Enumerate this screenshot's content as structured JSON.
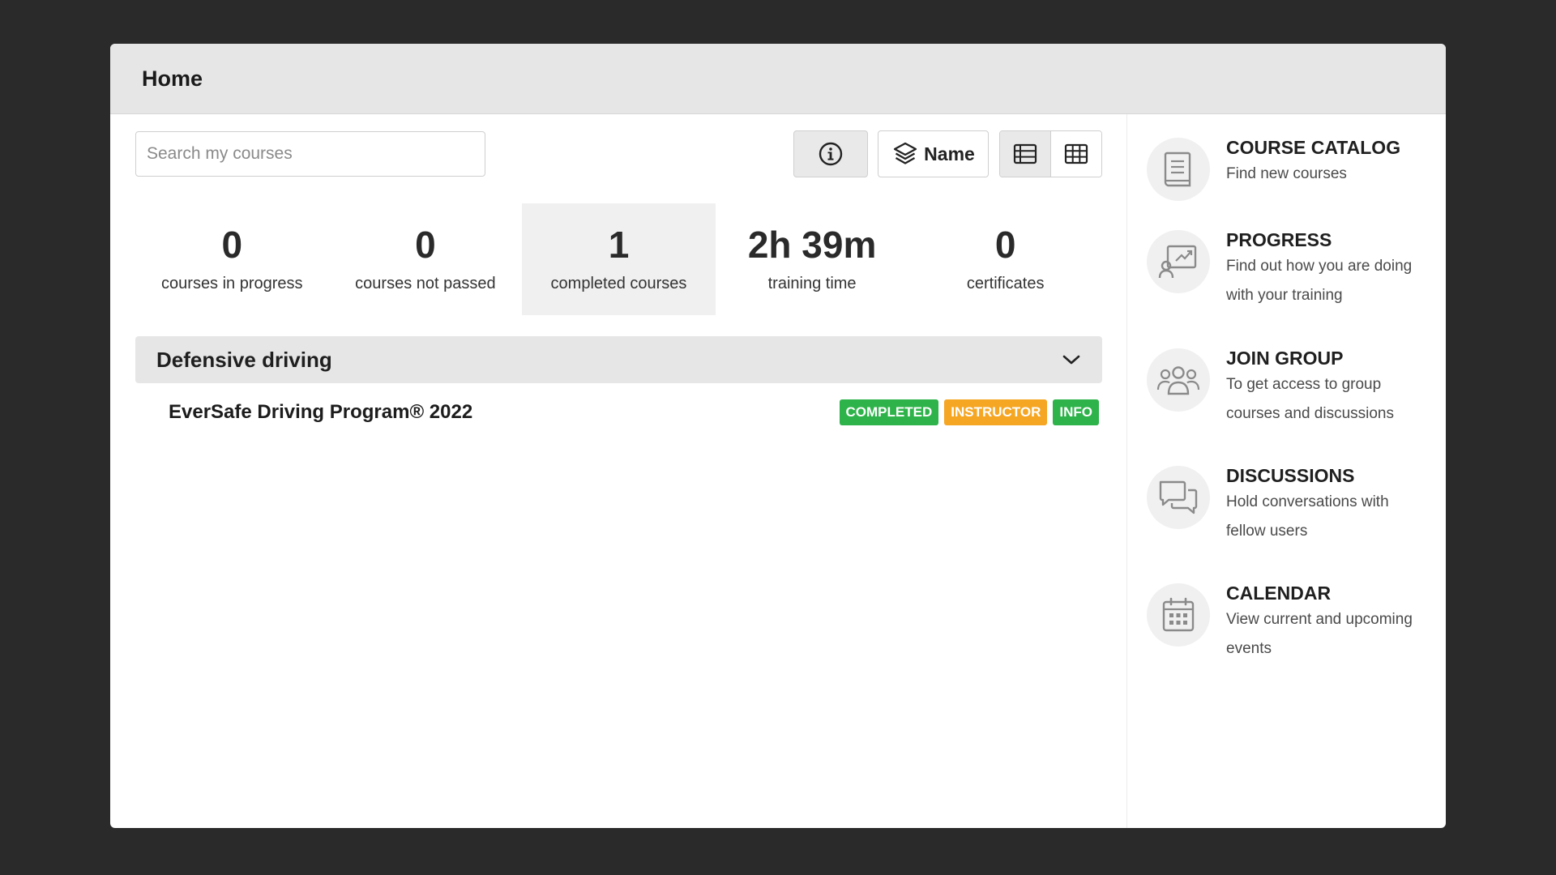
{
  "header": {
    "title": "Home"
  },
  "search": {
    "placeholder": "Search my courses"
  },
  "toolbar": {
    "sort_label": "Name"
  },
  "stats": [
    {
      "value": "0",
      "label": "courses in progress"
    },
    {
      "value": "0",
      "label": "courses not passed"
    },
    {
      "value": "1",
      "label": "completed courses"
    },
    {
      "value": "2h 39m",
      "label": "training time"
    },
    {
      "value": "0",
      "label": "certificates"
    }
  ],
  "category": {
    "title": "Defensive driving",
    "courses": [
      {
        "title": "EverSafe Driving Program® 2022",
        "badges": [
          {
            "label": "COMPLETED",
            "color": "#2db34a"
          },
          {
            "label": "INSTRUCTOR",
            "color": "#f5a623"
          },
          {
            "label": "INFO",
            "color": "#2db34a"
          }
        ]
      }
    ]
  },
  "sidebar": {
    "items": [
      {
        "title": "COURSE CATALOG",
        "desc": "Find new courses",
        "icon": "book-icon"
      },
      {
        "title": "PROGRESS",
        "desc": "Find out how you are doing with your training",
        "icon": "progress-chart-icon"
      },
      {
        "title": "JOIN GROUP",
        "desc": "To get access to group courses and discussions",
        "icon": "group-icon"
      },
      {
        "title": "DISCUSSIONS",
        "desc": "Hold conversations with fellow users",
        "icon": "chat-bubbles-icon"
      },
      {
        "title": "CALENDAR",
        "desc": "View current and upcoming events",
        "icon": "calendar-icon"
      }
    ]
  },
  "colors": {
    "background": "#2a2a2a",
    "header_bg": "#e6e6e6",
    "completed": "#2db34a",
    "instructor": "#f5a623"
  }
}
